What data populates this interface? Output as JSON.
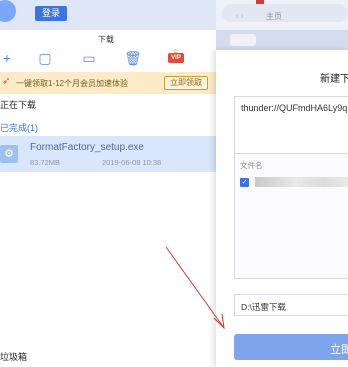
{
  "header": {
    "login_label": "登录",
    "tab_label": "下载"
  },
  "toolbar": {
    "icons": [
      "plus-icon",
      "file-icon",
      "folder-icon",
      "trash-icon",
      "vip-icon"
    ],
    "vip_label": "VIP"
  },
  "promo": {
    "text": "一键领取1-12个月会员加速体验",
    "button_label": "立即领取"
  },
  "list": {
    "downloading_label": "正在下载",
    "completed_label": "已完成(1)",
    "items": [
      {
        "name": "FormatFactory_setup.exe",
        "size": "83.72MB",
        "date": "2019-06-08 10:38"
      }
    ],
    "trash_label": "垃圾箱"
  },
  "browser": {
    "nav_arrows": "‹  ›",
    "home_label": "主页"
  },
  "dialog": {
    "title": "新建下",
    "url": "thunder://QUFmdHA6Ly9q",
    "files_header": "文件名",
    "save_path": "D:\\迅雷下载",
    "submit_label": "立即"
  },
  "colors": {
    "accent": "#3b74e0",
    "promo_bg": "#fcebc6",
    "selected_row": "#d9e6fb",
    "submit_bg": "#7fa4ee",
    "annotation": "#d43a2f"
  }
}
